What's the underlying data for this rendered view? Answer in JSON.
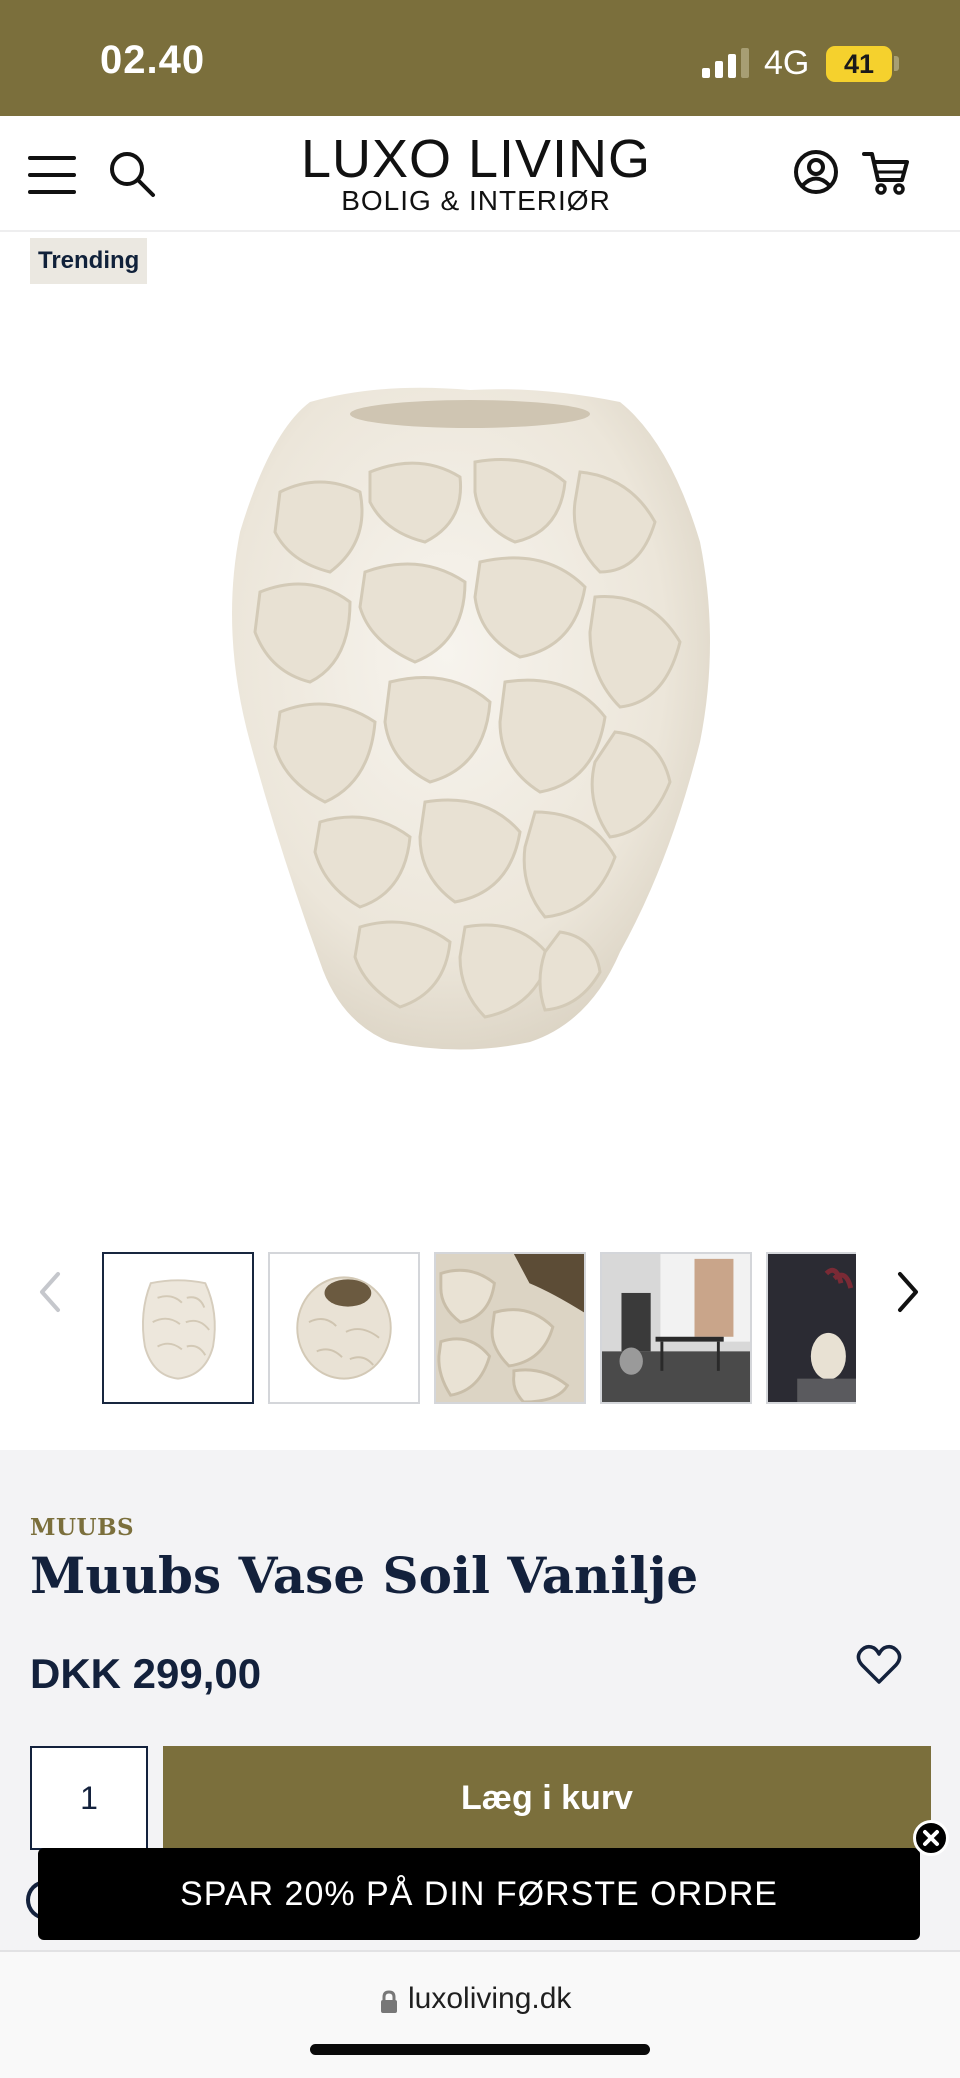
{
  "status_bar": {
    "time": "02.40",
    "network": "4G",
    "battery": "41"
  },
  "header": {
    "logo_main": "LUXO LIVING",
    "logo_sub": "BOLIG & INTERIØR"
  },
  "gallery": {
    "badge": "Trending",
    "thumbnails": [
      "vase-front",
      "vase-top",
      "vase-closeup",
      "interior-room",
      "interior-dark"
    ],
    "active_thumbnail": 0
  },
  "product": {
    "brand": "MUUBS",
    "title": "Muubs Vase Soil Vanilje",
    "price": "DKK 299,00",
    "quantity": "1",
    "add_to_cart": "Læg i kurv"
  },
  "promo": {
    "text": "SPAR 20% PÅ DIN FØRSTE ORDRE"
  },
  "browser": {
    "url": "luxoliving.dk"
  },
  "colors": {
    "brand_olive": "#7b6f3c",
    "navy": "#13213c",
    "battery_yellow": "#f5d12d"
  }
}
